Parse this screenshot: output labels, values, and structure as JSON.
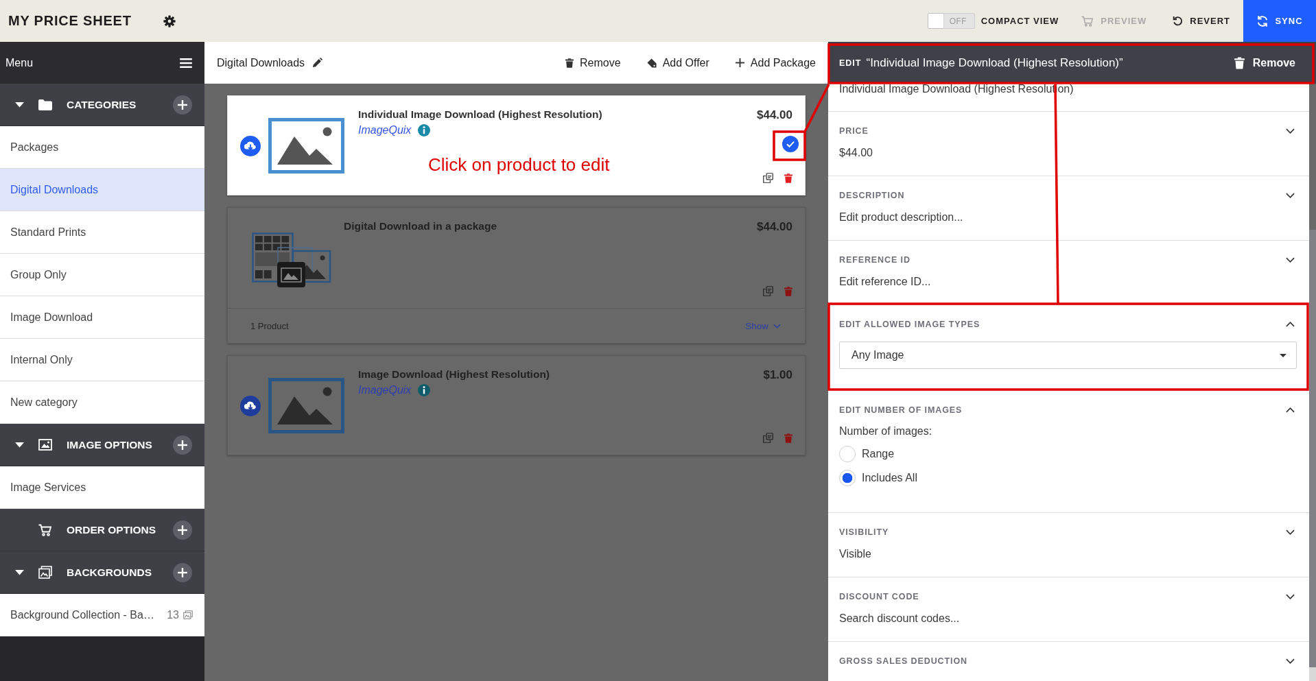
{
  "top_bar": {
    "title": "MY PRICE SHEET",
    "compact_toggle": {
      "on": false,
      "state_label": "OFF",
      "label": "COMPACT VIEW"
    },
    "actions": [
      {
        "kind": "preview",
        "label": "PREVIEW",
        "disabled": true
      },
      {
        "kind": "revert",
        "label": "REVERT",
        "disabled": false
      },
      {
        "kind": "sync",
        "label": "SYNC",
        "disabled": false
      }
    ]
  },
  "sidebar": {
    "title": "Menu",
    "sections": [
      {
        "kind": "categories",
        "label": "CATEGORIES",
        "items": [
          {
            "label": "Packages",
            "selected": false
          },
          {
            "label": "Digital Downloads",
            "selected": true
          },
          {
            "label": "Standard Prints",
            "selected": false
          },
          {
            "label": "Group Only",
            "selected": false
          },
          {
            "label": "Image Download",
            "selected": false
          },
          {
            "label": "Internal Only",
            "selected": false
          },
          {
            "label": "New category",
            "selected": false
          }
        ]
      },
      {
        "kind": "image_options",
        "label": "IMAGE OPTIONS",
        "items": [
          {
            "label": "Image Services",
            "selected": false
          }
        ]
      },
      {
        "kind": "order_options",
        "label": "ORDER OPTIONS"
      },
      {
        "kind": "backgrounds",
        "label": "BACKGROUNDS",
        "items": [
          {
            "label": "Background Collection - Ba…",
            "count": "13",
            "selected": false
          }
        ]
      }
    ]
  },
  "toolbar": {
    "title": "Digital Downloads",
    "actions": [
      {
        "kind": "remove",
        "label": "Remove"
      },
      {
        "kind": "add_offer",
        "label": "Add Offer"
      },
      {
        "kind": "add_package",
        "label": "Add Package"
      }
    ]
  },
  "products": [
    {
      "kind": "product",
      "selected": true,
      "title": "Individual Image Download (Highest Resolution)",
      "vendor": "ImageQuix",
      "price": "$44.00"
    },
    {
      "kind": "package",
      "selected": false,
      "title": "Digital Download in a package",
      "price": "$44.00",
      "footer": {
        "count": "1 Product",
        "toggle": "Show"
      }
    },
    {
      "kind": "product",
      "selected": false,
      "title": "Image Download (Highest Resolution)",
      "vendor": "ImageQuix",
      "price": "$1.00"
    }
  ],
  "annotation": {
    "text": "Click on product to edit"
  },
  "edit_panel": {
    "prefix": "EDIT",
    "title": "“Individual Image Download (Highest Resolution)”",
    "remove": "Remove",
    "name_value": "Individual Image Download (Highest Resolution)",
    "sections": [
      {
        "kind": "text",
        "label": "PRICE",
        "value": "$44.00",
        "expanded": false
      },
      {
        "kind": "text",
        "label": "DESCRIPTION",
        "value": "Edit product description...",
        "expanded": false
      },
      {
        "kind": "text",
        "label": "REFERENCE ID",
        "value": "Edit reference ID...",
        "expanded": false
      },
      {
        "kind": "select",
        "label": "EDIT ALLOWED IMAGE TYPES",
        "value": "Any Image",
        "expanded": true
      },
      {
        "kind": "radio",
        "label": "EDIT NUMBER OF IMAGES",
        "prompt": "Number of images:",
        "options": [
          {
            "label": "Range",
            "selected": false
          },
          {
            "label": "Includes All",
            "selected": true
          }
        ],
        "expanded": true
      },
      {
        "kind": "text",
        "label": "VISIBILITY",
        "value": "Visible",
        "expanded": false
      },
      {
        "kind": "text",
        "label": "DISCOUNT CODE",
        "value": "Search discount codes...",
        "expanded": false
      },
      {
        "kind": "text",
        "label": "GROSS SALES DEDUCTION",
        "expanded": false
      }
    ]
  }
}
